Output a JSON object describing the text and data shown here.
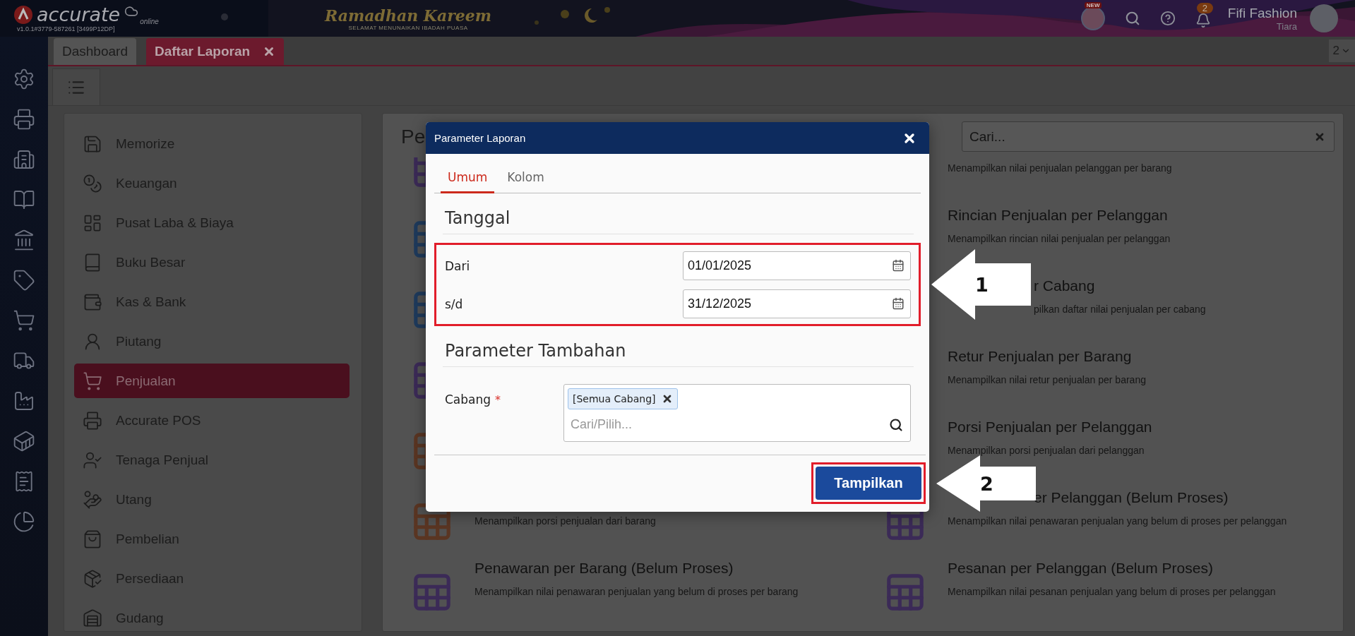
{
  "header": {
    "logo": "accurate",
    "logo_sub": "online",
    "version": "v1.0.1#3779-587261 [3499P12DP]",
    "banner_title": "Ramadhan Kareem",
    "banner_subtitle": "SELAMAT MENUNAIKAN IBADAH PUASA",
    "new_badge": "NEW",
    "notification_count": "2",
    "company": "Fifi Fashion",
    "user": "Tiara"
  },
  "tabs": [
    {
      "label": "Dashboard",
      "selected": false,
      "closable": false
    },
    {
      "label": "Daftar Laporan",
      "selected": true,
      "closable": true
    }
  ],
  "tab_count": "2",
  "menu": [
    {
      "label": "Memorize",
      "selected": false
    },
    {
      "label": "Keuangan",
      "selected": false
    },
    {
      "label": "Pusat Laba & Biaya",
      "selected": false
    },
    {
      "label": "Buku Besar",
      "selected": false
    },
    {
      "label": "Kas & Bank",
      "selected": false
    },
    {
      "label": "Piutang",
      "selected": false
    },
    {
      "label": "Penjualan",
      "selected": true
    },
    {
      "label": "Accurate POS",
      "selected": false
    },
    {
      "label": "Tenaga Penjual",
      "selected": false
    },
    {
      "label": "Utang",
      "selected": false
    },
    {
      "label": "Pembelian",
      "selected": false
    },
    {
      "label": "Persediaan",
      "selected": false
    },
    {
      "label": "Gudang",
      "selected": false
    }
  ],
  "report_panel": {
    "heading": "Pe",
    "search_placeholder": "Cari...",
    "rows": [
      {
        "left": {
          "kind": "full",
          "color": "#3b2a57"
        },
        "right": {
          "kind": "full",
          "desc": "Menampilkan nilai penjualan pelanggan per barang"
        }
      },
      {
        "left": {
          "kind": "full",
          "color": "#1e3a5c"
        },
        "right": {
          "kind": "full",
          "title": "Rincian Penjualan per Pelanggan",
          "desc": "Menampilkan rincian nilai penjualan per pelanggan"
        }
      },
      {
        "left": {
          "kind": "full",
          "color": "#1e3a5c"
        },
        "right": {
          "kind": "cut_both",
          "title": "r Cabang",
          "desc": "pilkan daftar nilai penjualan per cabang"
        }
      },
      {
        "left": {
          "kind": "full",
          "color": "#3b2a57"
        },
        "right": {
          "kind": "full",
          "title": "Retur Penjualan per Barang",
          "desc": "Menampilkan nilai retur penjualan per barang"
        }
      },
      {
        "left": {
          "kind": "full",
          "color": "#5a3522"
        },
        "right": {
          "kind": "full",
          "title": "Porsi Penjualan per Pelanggan",
          "desc": "Menampilkan porsi penjualan dari pelanggan"
        }
      },
      {
        "left": {
          "kind": "full",
          "color": "#5a3522",
          "desc": "Menampilkan porsi penjualan dari barang"
        },
        "right": {
          "kind": "cut_title",
          "color": "#3b2a57",
          "title": "er Pelanggan (Belum Proses)",
          "desc": "Menampilkan nilai penawaran penjualan yang belum di proses per pelanggan"
        }
      },
      {
        "left": {
          "kind": "full",
          "color": "#3b2a57",
          "title": "Penawaran per Barang (Belum Proses)",
          "desc": "Menampilkan nilai penawaran penjualan yang belum di proses per barang"
        },
        "right": {
          "kind": "full",
          "color": "#3b2a57",
          "title": "Pesanan per Pelanggan (Belum Proses)",
          "desc": "Menampilkan nilai pesanan penjualan yang belum di proses per pelanggan"
        }
      }
    ]
  },
  "dialog": {
    "title": "Parameter Laporan",
    "tabs": [
      {
        "label": "Umum",
        "selected": true
      },
      {
        "label": "Kolom",
        "selected": false
      }
    ],
    "sections": [
      {
        "heading": "Tanggal",
        "highlighted": true,
        "callout": "1",
        "fields": [
          {
            "kind": "date",
            "label": "Dari",
            "value": "01/01/2025"
          },
          {
            "kind": "date",
            "label": "s/d",
            "value": "31/12/2025"
          }
        ]
      },
      {
        "heading": "Parameter Tambahan",
        "highlighted": false,
        "fields": [
          {
            "kind": "multiselect",
            "label": "Cabang",
            "required_mark": "*",
            "tags": [
              "[Semua Cabang]"
            ],
            "placeholder": "Cari/Pilih..."
          }
        ]
      }
    ],
    "submit": {
      "label": "Tampilkan",
      "highlighted": true,
      "callout": "2"
    }
  }
}
